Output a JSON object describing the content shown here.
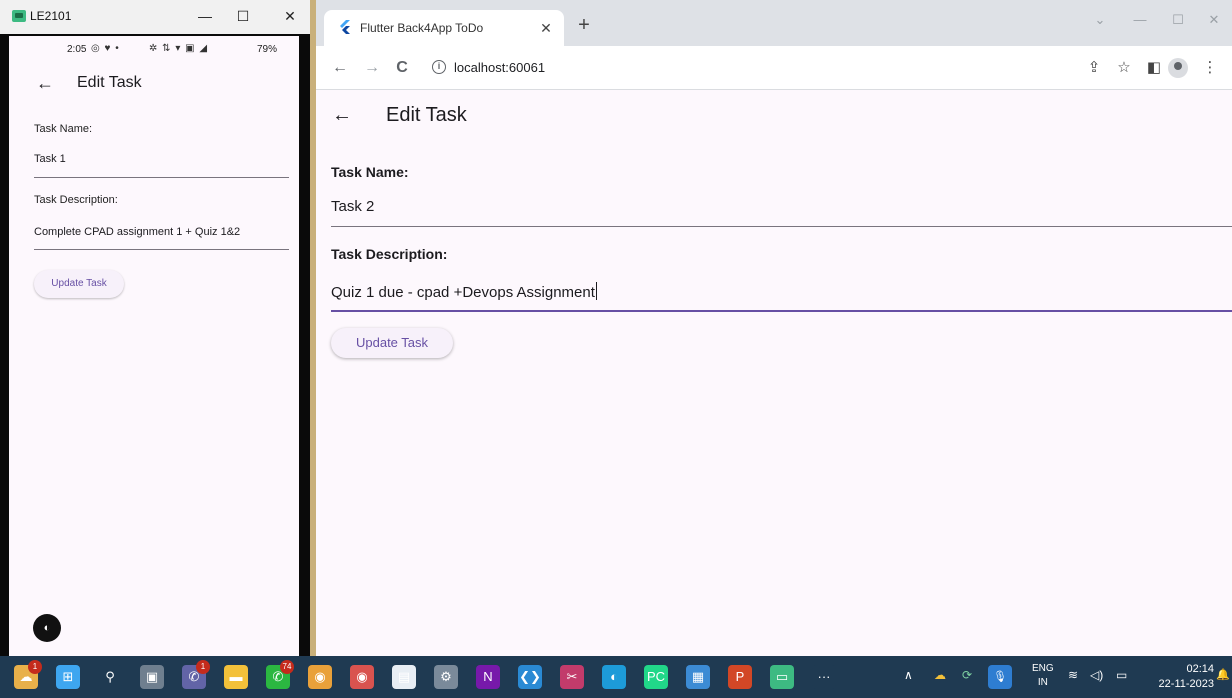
{
  "emulator": {
    "window_title": "LE2101",
    "controls": {
      "minimize": "—",
      "maximize": "☐",
      "close": "✕"
    },
    "status_bar": {
      "time": "2:05",
      "icons_left": "◎ ♥ •",
      "icons_right": "✲ ⇅ ▾ ▣ ◢",
      "battery": "79%"
    },
    "app": {
      "title": "Edit Task",
      "back_glyph": "←",
      "task_name_label": "Task Name:",
      "task_name_value": "Task 1",
      "task_description_label": "Task Description:",
      "task_description_value": "Complete CPAD assignment 1 + Quiz 1&2",
      "update_button": "Update Task",
      "fab_glyph": "◐"
    }
  },
  "browser": {
    "tab_title": "Flutter Back4App ToDo",
    "tab_close": "✕",
    "new_tab": "+",
    "url": "localhost:60061",
    "window_controls": {
      "dropdown": "⌄",
      "minimize": "—",
      "maximize": "☐",
      "close": "✕"
    },
    "nav": {
      "back": "←",
      "forward": "→",
      "reload": "C"
    },
    "toolbar_icons": {
      "share": "⇪",
      "star": "☆",
      "sidepanel": "◧"
    }
  },
  "app": {
    "title": "Edit Task",
    "back_glyph": "←",
    "task_name_label": "Task Name:",
    "task_name_value": "Task 2",
    "task_description_label": "Task Description:",
    "task_description_value": "Quiz 1 due - cpad +Devops Assignment",
    "update_button": "Update Task"
  },
  "taskbar": {
    "apps": [
      {
        "name": "weather",
        "glyph": "☁",
        "color": "#e8b04a",
        "badge": "1"
      },
      {
        "name": "start",
        "glyph": "⊞",
        "color": "#3ea6f0",
        "badge": ""
      },
      {
        "name": "search",
        "glyph": "⚲",
        "color": "#1f3a52",
        "badge": ""
      },
      {
        "name": "task-view",
        "glyph": "▣",
        "color": "#6f7f8f",
        "badge": ""
      },
      {
        "name": "teams",
        "glyph": "✆",
        "color": "#6264a7",
        "badge": "1"
      },
      {
        "name": "file-explorer",
        "glyph": "▬",
        "color": "#f3c13a",
        "badge": ""
      },
      {
        "name": "whatsapp",
        "glyph": "✆",
        "color": "#2bb741",
        "badge": "74"
      },
      {
        "name": "chrome",
        "glyph": "◉",
        "color": "#e9a13a",
        "badge": ""
      },
      {
        "name": "chrome-profile",
        "glyph": "◉",
        "color": "#d9534f",
        "badge": ""
      },
      {
        "name": "notepad",
        "glyph": "▤",
        "color": "#e8eef4",
        "badge": ""
      },
      {
        "name": "settings",
        "glyph": "⚙",
        "color": "#7a8a9a",
        "badge": ""
      },
      {
        "name": "onenote",
        "glyph": "N",
        "color": "#7719aa",
        "badge": ""
      },
      {
        "name": "vscode",
        "glyph": "❮❯",
        "color": "#2a8ad4",
        "badge": ""
      },
      {
        "name": "snipping-tool",
        "glyph": "✂",
        "color": "#c23b6b",
        "badge": ""
      },
      {
        "name": "edge",
        "glyph": "◐",
        "color": "#1d9bd8",
        "badge": ""
      },
      {
        "name": "pycharm",
        "glyph": "PC",
        "color": "#21d789",
        "badge": ""
      },
      {
        "name": "control-panel",
        "glyph": "▦",
        "color": "#3c8bd4",
        "badge": ""
      },
      {
        "name": "powerpoint",
        "glyph": "P",
        "color": "#d24726",
        "badge": ""
      },
      {
        "name": "android-emulator",
        "glyph": "▭",
        "color": "#3dba82",
        "badge": ""
      },
      {
        "name": "more",
        "glyph": "···",
        "color": "#1f3a52",
        "badge": ""
      }
    ],
    "tray": {
      "chevron": "∧",
      "onedrive": "☁",
      "sync": "⟳",
      "mic": "🎙",
      "lang_top": "ENG",
      "lang_bottom": "IN",
      "wifi": "≋",
      "volume": "◁)",
      "battery": "▭",
      "time": "02:14",
      "date": "22-11-2023",
      "notification": "🔔"
    }
  }
}
